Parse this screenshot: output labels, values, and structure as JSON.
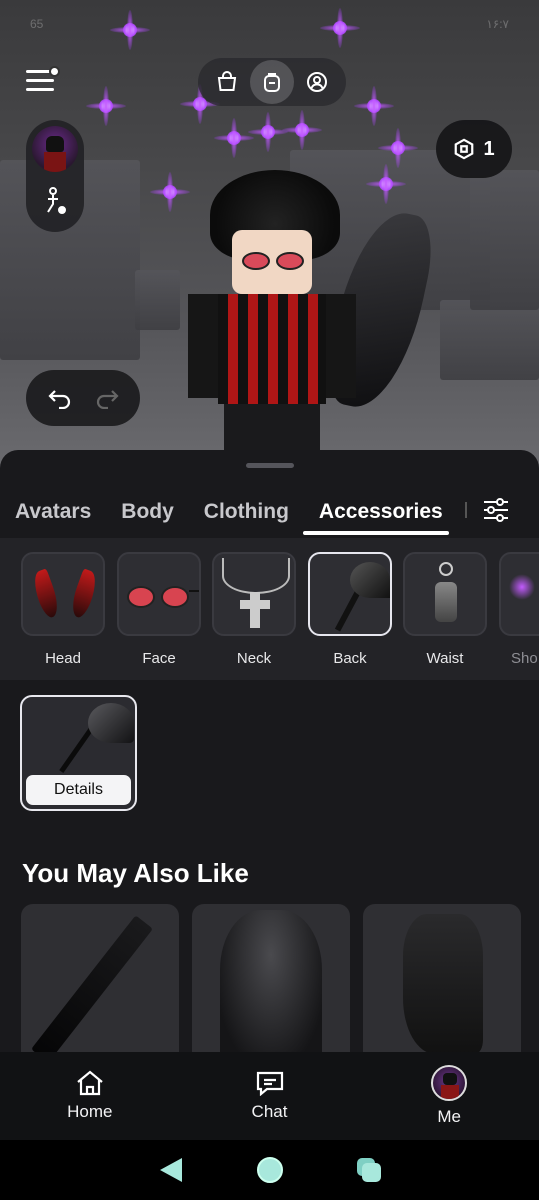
{
  "status_bar": {
    "left": "65",
    "right": "۱۶:۷"
  },
  "robux": {
    "amount": "1"
  },
  "tabs": [
    {
      "label": "Avatars"
    },
    {
      "label": "Body"
    },
    {
      "label": "Clothing"
    },
    {
      "label": "Accessories"
    }
  ],
  "categories": [
    {
      "label": "Head"
    },
    {
      "label": "Face"
    },
    {
      "label": "Neck"
    },
    {
      "label": "Back"
    },
    {
      "label": "Waist"
    },
    {
      "label": "Sho"
    }
  ],
  "selected_item": {
    "details_label": "Details"
  },
  "recommendations": {
    "title": "You May Also Like"
  },
  "bottom_nav": [
    {
      "label": "Home",
      "icon": "home-icon"
    },
    {
      "label": "Chat",
      "icon": "chat-icon"
    },
    {
      "label": "Me",
      "icon": "avatar"
    }
  ],
  "colors": {
    "accent_purple": "#b44dff",
    "sheet_bg": "#19191c",
    "selected_border": "#e8e8ee"
  }
}
